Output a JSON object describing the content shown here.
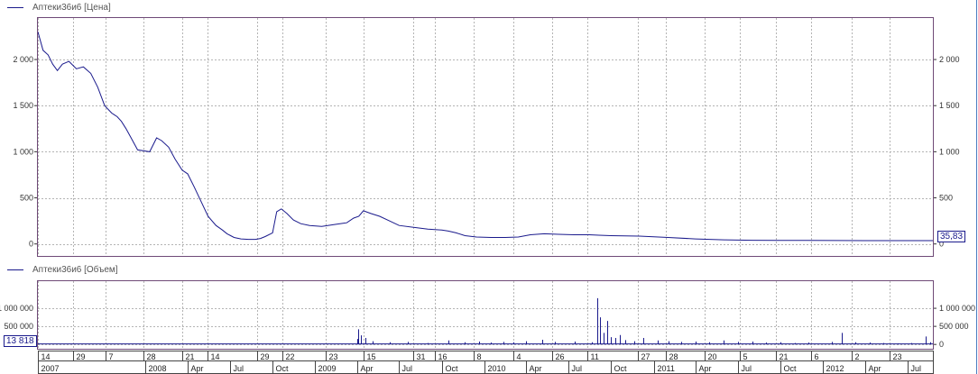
{
  "top_legend": {
    "label": "Аптеки36и6 [Цена]"
  },
  "bottom_legend": {
    "label": "Аптеки36и6 [Объем]"
  },
  "price_badge": "35,83",
  "volume_badge": "13 818",
  "colors": {
    "series": "#1a1a8c",
    "frame": "#6f4a77",
    "grid": "#b4b4b4",
    "right_edge": "#4a7cc0"
  },
  "chart_data": [
    {
      "type": "line",
      "title": "",
      "ylim": [
        -130,
        2450
      ],
      "yticks": [
        0,
        500,
        1000,
        1500,
        2000
      ],
      "ytick_labels": [
        "0",
        "500",
        "1 000",
        "1 500",
        "2 000"
      ],
      "xlim": [
        "2007-05-14",
        "2012-08-25"
      ],
      "grid": true,
      "series": [
        {
          "name": "Аптеки36и6 [Цена]",
          "x": [
            "2007-05-14",
            "2007-05-25",
            "2007-06-05",
            "2007-06-15",
            "2007-06-25",
            "2007-07-06",
            "2007-07-20",
            "2007-08-05",
            "2007-08-20",
            "2007-09-05",
            "2007-09-20",
            "2007-10-05",
            "2007-10-20",
            "2007-11-01",
            "2007-11-10",
            "2007-11-20",
            "2007-12-01",
            "2007-12-15",
            "2008-01-10",
            "2008-01-25",
            "2008-02-05",
            "2008-02-20",
            "2008-03-05",
            "2008-03-20",
            "2008-04-01",
            "2008-04-15",
            "2008-05-01",
            "2008-05-15",
            "2008-06-01",
            "2008-06-15",
            "2008-06-25",
            "2008-07-10",
            "2008-07-25",
            "2008-08-10",
            "2008-08-25",
            "2008-09-05",
            "2008-09-15",
            "2008-10-01",
            "2008-10-10",
            "2008-10-20",
            "2008-11-01",
            "2008-11-15",
            "2008-12-01",
            "2008-12-20",
            "2009-01-15",
            "2009-02-10",
            "2009-03-10",
            "2009-03-25",
            "2009-04-05",
            "2009-04-15",
            "2009-05-01",
            "2009-05-20",
            "2009-06-10",
            "2009-07-01",
            "2009-08-01",
            "2009-09-01",
            "2009-10-01",
            "2009-10-15",
            "2009-11-01",
            "2009-11-20",
            "2009-12-15",
            "2010-01-15",
            "2010-02-15",
            "2010-03-15",
            "2010-04-10",
            "2010-05-10",
            "2010-06-10",
            "2010-07-15",
            "2010-08-15",
            "2010-09-05",
            "2010-10-01",
            "2010-12-01",
            "2011-02-01",
            "2011-04-01",
            "2011-06-01",
            "2011-08-01",
            "2011-10-01",
            "2011-12-01",
            "2012-02-01",
            "2012-04-01",
            "2012-06-01",
            "2012-08-25"
          ],
          "y": [
            2300,
            2100,
            2050,
            1950,
            1880,
            1950,
            1980,
            1900,
            1920,
            1850,
            1700,
            1500,
            1420,
            1380,
            1330,
            1250,
            1150,
            1020,
            1000,
            1150,
            1120,
            1050,
            920,
            800,
            760,
            620,
            450,
            300,
            200,
            150,
            110,
            70,
            55,
            50,
            50,
            60,
            80,
            120,
            350,
            380,
            330,
            260,
            220,
            200,
            190,
            210,
            230,
            280,
            300,
            360,
            330,
            300,
            250,
            200,
            180,
            160,
            150,
            140,
            120,
            90,
            75,
            70,
            70,
            75,
            100,
            110,
            105,
            100,
            100,
            95,
            90,
            85,
            70,
            55,
            45,
            40,
            38,
            38,
            37,
            36,
            36,
            35.83
          ]
        }
      ]
    },
    {
      "type": "bar",
      "title": "",
      "ylim": [
        -120000,
        1750000
      ],
      "yticks": [
        0,
        500000,
        1000000
      ],
      "ytick_labels": [
        "0",
        "500 000",
        "1 000 000"
      ],
      "left_tick_labels": [
        "500 000",
        "1 000 000"
      ],
      "xlim": [
        "2007-05-14",
        "2012-08-25"
      ],
      "grid": true,
      "series": [
        {
          "name": "Аптеки36и6 [Объем]",
          "x": [
            "2009-04-01",
            "2009-04-04",
            "2009-04-10",
            "2009-04-20",
            "2009-05-05",
            "2009-06-10",
            "2009-07-20",
            "2009-09-01",
            "2009-10-15",
            "2009-11-20",
            "2009-12-20",
            "2010-01-15",
            "2010-02-10",
            "2010-03-05",
            "2010-04-01",
            "2010-05-05",
            "2010-06-01",
            "2010-07-15",
            "2010-08-20",
            "2010-09-01",
            "2010-09-08",
            "2010-09-15",
            "2010-09-22",
            "2010-10-01",
            "2010-10-10",
            "2010-10-20",
            "2010-11-01",
            "2010-11-20",
            "2010-12-10",
            "2011-01-10",
            "2011-02-01",
            "2011-03-01",
            "2011-04-01",
            "2011-05-01",
            "2011-06-01",
            "2011-07-01",
            "2011-08-01",
            "2011-09-01",
            "2011-10-01",
            "2011-11-01",
            "2011-12-01",
            "2012-01-20",
            "2012-02-10",
            "2012-03-10",
            "2012-04-10",
            "2012-05-10",
            "2012-06-10",
            "2012-07-10",
            "2012-08-10",
            "2012-08-20"
          ],
          "values": [
            150000,
            420000,
            250000,
            180000,
            90000,
            60000,
            70000,
            40000,
            110000,
            60000,
            80000,
            50000,
            70000,
            60000,
            90000,
            130000,
            70000,
            80000,
            60000,
            1280000,
            750000,
            320000,
            650000,
            200000,
            180000,
            260000,
            120000,
            90000,
            180000,
            110000,
            90000,
            70000,
            80000,
            60000,
            110000,
            70000,
            80000,
            50000,
            60000,
            40000,
            50000,
            70000,
            320000,
            60000,
            50000,
            40000,
            30000,
            40000,
            220000,
            60000
          ]
        }
      ]
    }
  ],
  "x_axis": {
    "day_ticks": [
      {
        "date": "2007-05-14",
        "label": "14"
      },
      {
        "date": "2007-07-29",
        "label": "29"
      },
      {
        "date": "2007-10-07",
        "label": "7"
      },
      {
        "date": "2007-12-28",
        "label": "28"
      },
      {
        "date": "2008-03-21",
        "label": "21"
      },
      {
        "date": "2008-05-14",
        "label": "14"
      },
      {
        "date": "2008-08-29",
        "label": "29"
      },
      {
        "date": "2008-10-22",
        "label": "22"
      },
      {
        "date": "2009-01-23",
        "label": "23"
      },
      {
        "date": "2009-04-15",
        "label": "15"
      },
      {
        "date": "2009-07-31",
        "label": "31"
      },
      {
        "date": "2009-09-16",
        "label": "16"
      },
      {
        "date": "2009-12-08",
        "label": "8"
      },
      {
        "date": "2010-03-04",
        "label": "4"
      },
      {
        "date": "2010-05-26",
        "label": "26"
      },
      {
        "date": "2010-08-11",
        "label": "11"
      },
      {
        "date": "2010-11-27",
        "label": "27"
      },
      {
        "date": "2011-01-28",
        "label": "28"
      },
      {
        "date": "2011-04-20",
        "label": "20"
      },
      {
        "date": "2011-07-05",
        "label": "5"
      },
      {
        "date": "2011-09-21",
        "label": "21"
      },
      {
        "date": "2011-12-06",
        "label": "6"
      },
      {
        "date": "2012-03-02",
        "label": "2"
      },
      {
        "date": "2012-05-23",
        "label": "23"
      }
    ],
    "period_ticks": [
      {
        "date": "2007-05-14",
        "label": "2007"
      },
      {
        "date": "2008-01-01",
        "label": "2008"
      },
      {
        "date": "2008-04-01",
        "label": "Apr"
      },
      {
        "date": "2008-07-01",
        "label": "Jul"
      },
      {
        "date": "2008-10-01",
        "label": "Oct"
      },
      {
        "date": "2009-01-01",
        "label": "2009"
      },
      {
        "date": "2009-04-01",
        "label": "Apr"
      },
      {
        "date": "2009-07-01",
        "label": "Jul"
      },
      {
        "date": "2009-10-01",
        "label": "Oct"
      },
      {
        "date": "2010-01-01",
        "label": "2010"
      },
      {
        "date": "2010-04-01",
        "label": "Apr"
      },
      {
        "date": "2010-07-01",
        "label": "Jul"
      },
      {
        "date": "2010-10-01",
        "label": "Oct"
      },
      {
        "date": "2011-01-01",
        "label": "2011"
      },
      {
        "date": "2011-04-01",
        "label": "Apr"
      },
      {
        "date": "2011-07-01",
        "label": "Jul"
      },
      {
        "date": "2011-10-01",
        "label": "Oct"
      },
      {
        "date": "2012-01-01",
        "label": "2012"
      },
      {
        "date": "2012-04-01",
        "label": "Apr"
      },
      {
        "date": "2012-07-01",
        "label": "Jul"
      }
    ]
  }
}
